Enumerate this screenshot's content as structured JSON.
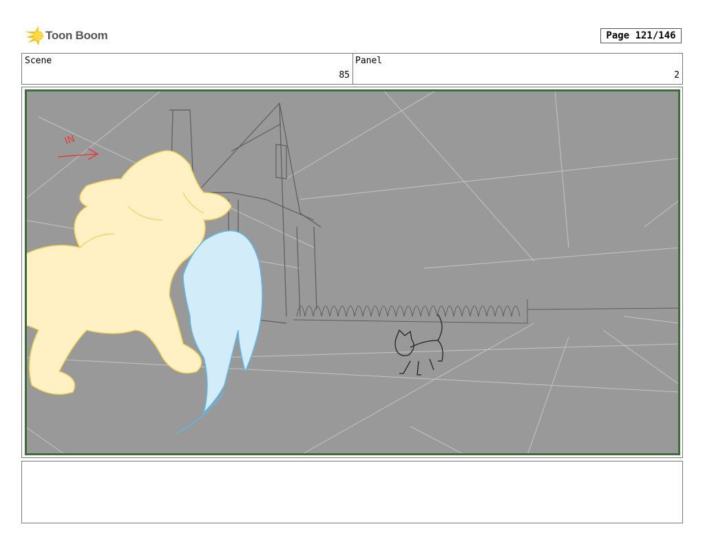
{
  "header": {
    "brand_name": "Toon Boom",
    "page_label": "Page 121/146"
  },
  "scene": {
    "label": "Scene",
    "value": "85"
  },
  "panel": {
    "label": "Panel",
    "value": "2"
  },
  "artwork": {
    "annotation": "IN",
    "colors": {
      "background": "#999999",
      "border": "#3f6b3a",
      "lion_fill": "#fff1c4",
      "lion_stroke": "#f2cf5a",
      "hair_fill": "#d2ecfa",
      "hair_stroke": "#5fb7e8",
      "sketch_line": "#5c5c5c",
      "perspective_line": "#c4c4c4",
      "annotation_red": "#e23b3b"
    }
  },
  "notes": {
    "text": ""
  }
}
